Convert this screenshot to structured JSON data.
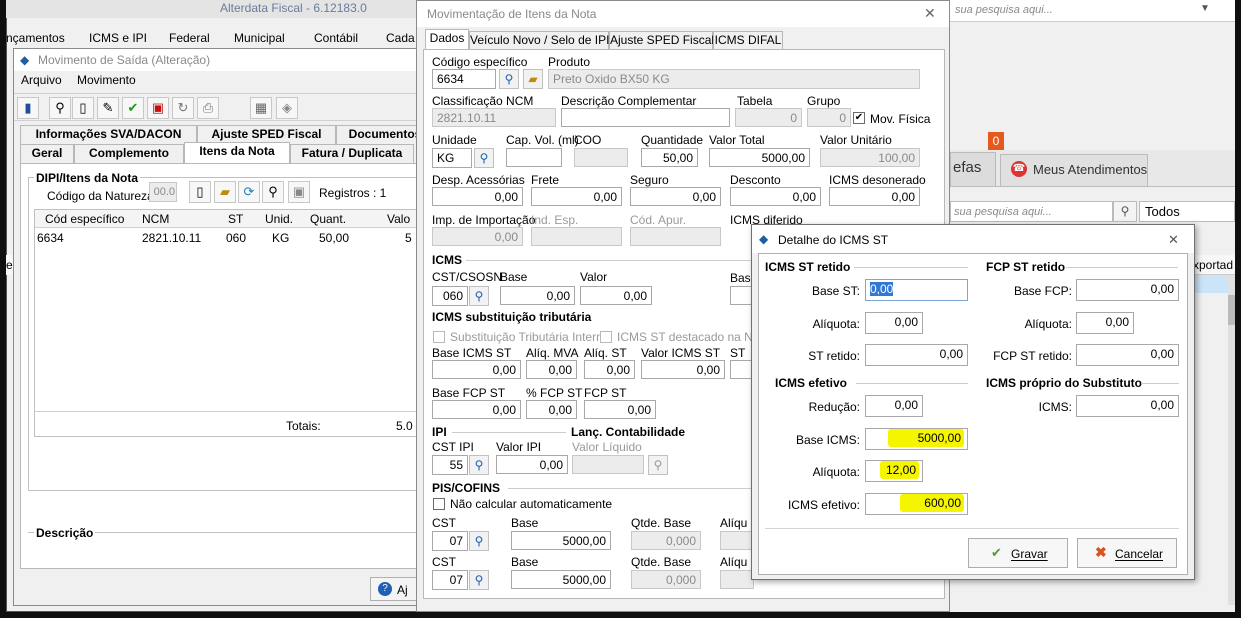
{
  "top": {
    "title_fragment": "Alterdata Fiscal - 6.12183.0",
    "search_placeholder": "sua pesquisa aqui...",
    "menu_items": [
      "nçamentos",
      "ICMS e IPI",
      "Federal",
      "Municipal",
      "Contábil",
      "Cada"
    ]
  },
  "bg_right": {
    "tab_fragment": "efas",
    "badge": "0",
    "tab_meus": "Meus Atendimentos",
    "search_placeholder": "sua pesquisa aqui...",
    "filter_value": "Todos",
    "column_fragment": "xportad",
    "left_fragment": "er"
  },
  "movimento": {
    "title": "Movimento de Saída (Alteração)",
    "menu_arquivo": "Arquivo",
    "menu_movimento": "Movimento",
    "tabs_row1": [
      "Informações SVA/DACON",
      "Ajuste SPED Fiscal",
      "Documentos"
    ],
    "tabs_row2": [
      "Geral",
      "Complemento",
      "Itens da Nota",
      "Fatura / Duplicata"
    ],
    "group_title": "DIPI/Itens da Nota",
    "natureza_label": "Código da Natureza",
    "natureza_value": "00.0",
    "registros_label": "Registros : 1",
    "columns": [
      "Cód específico",
      "NCM",
      "ST",
      "Unid.",
      "Quant.",
      "Valo"
    ],
    "row": [
      "6634",
      "2821.10.11",
      "060",
      "KG",
      "50,00",
      "5"
    ],
    "totais_label": "Totais:",
    "totais_value": "5.0",
    "descricao_label": "Descrição",
    "bottom_button": "Aj"
  },
  "mov_itens": {
    "title": "Movimentação de Itens da Nota",
    "tabs": [
      "Dados",
      "Veículo Novo / Selo de IPI",
      "Ajuste SPED Fiscal",
      "ICMS DIFAL"
    ],
    "codigo_label": "Código específico",
    "codigo_value": "6634",
    "produto_label": "Produto",
    "produto_value": "Preto Oxido BX50 KG",
    "ncm_label": "Classificação NCM",
    "ncm_value": "2821.10.11",
    "desc_comp_label": "Descrição Complementar",
    "tabela_label": "Tabela",
    "tabela_value": "0",
    "grupo_label": "Grupo",
    "grupo_value": "0",
    "mov_fisica_label": "Mov. Física",
    "mov_fisica_check": "✔",
    "unidade_label": "Unidade",
    "unidade_value": "KG",
    "capvol_label": "Cap. Vol. (ml)",
    "coo_label": "COO",
    "quantidade_label": "Quantidade",
    "quantidade_value": "50,00",
    "valor_total_label": "Valor Total",
    "valor_total_value": "5000,00",
    "valor_unit_label": "Valor Unitário",
    "valor_unit_value": "100,00",
    "desp_label": "Desp. Acessórias",
    "desp_value": "0,00",
    "frete_label": "Frete",
    "frete_value": "0,00",
    "seguro_label": "Seguro",
    "seguro_value": "0,00",
    "desconto_label": "Desconto",
    "desconto_value": "0,00",
    "icms_deson_label": "ICMS desonerado",
    "icms_deson_value": "0,00",
    "imp_label": "Imp. de Importação",
    "imp_value": "0,00",
    "ind_esp_label": "Ind. Esp.",
    "cod_apur_label": "Cód. Apur.",
    "icms_dif_label": "ICMS diferido",
    "icms_section": "ICMS",
    "cst_label": "CST/CSOSN",
    "cst_value": "060",
    "base_label": "Base",
    "base_value": "0,00",
    "valor_label": "Valor",
    "valor_value": "0,00",
    "bas_fragment": "Bas",
    "st_section": "ICMS substituição tributária",
    "st_interna_label": "Substituição Tributária Interna",
    "st_destacado_label": "ICMS ST destacado na NF",
    "base_icms_st_label": "Base ICMS ST",
    "base_icms_st_value": "0,00",
    "aliq_mva_label": "Alíq. MVA",
    "aliq_mva_value": "0,00",
    "aliq_st_label": "Alíq. ST",
    "aliq_st_value": "0,00",
    "valor_icms_st_label": "Valor ICMS ST",
    "valor_icms_st_value": "0,00",
    "st_fragment": "ST",
    "base_fcp_st_label": "Base FCP ST",
    "base_fcp_st_value": "0,00",
    "pct_fcp_st_label": "% FCP ST",
    "pct_fcp_st_value": "0,00",
    "fcp_st_label": "FCP ST",
    "fcp_st_value": "0,00",
    "ipi_section": "IPI",
    "lanc_section": "Lanç. Contabilidade",
    "cst_ipi_label": "CST IPI",
    "cst_ipi_value": "55",
    "valor_ipi_label": "Valor IPI",
    "valor_ipi_value": "0,00",
    "valor_liquido_label": "Valor Líquido",
    "pis_section": "PIS/COFINS",
    "nao_calc_label": "Não calcular automaticamente",
    "pis_cst_label": "CST",
    "pis_cst_value": "07",
    "pis_base_label": "Base",
    "pis_base_value": "5000,00",
    "pis_qtde_label": "Qtde. Base",
    "pis_qtde_value": "0,000",
    "pis_aliq_label": "Alíqu",
    "cof_cst_label": "CST",
    "cof_cst_value": "07",
    "cof_base_label": "Base",
    "cof_base_value": "5000,00",
    "cof_qtde_label": "Qtde. Base",
    "cof_qtde_value": "0,000",
    "cof_aliq_label": "Alíqu"
  },
  "detalhe": {
    "title": "Detalhe do ICMS ST",
    "icms_st_retido_section": "ICMS ST retido",
    "fcp_st_retido_section": "FCP ST retido",
    "base_st_label": "Base ST:",
    "base_st_value": "0,00",
    "base_fcp_label": "Base FCP:",
    "base_fcp_value": "0,00",
    "aliquota_label": "Alíquota:",
    "aliquota_value": "0,00",
    "aliquota_fcp_label": "Alíquota:",
    "aliquota_fcp_value": "0,00",
    "st_retido_label": "ST retido:",
    "st_retido_value": "0,00",
    "fcp_st_retido_label": "FCP ST retido:",
    "fcp_st_retido_value": "0,00",
    "icms_efetivo_section": "ICMS efetivo",
    "icms_proprio_section": "ICMS próprio do Substituto",
    "reducao_label": "Redução:",
    "reducao_value": "0,00",
    "icms_label": "ICMS:",
    "icms_value": "0,00",
    "base_icms_label": "Base ICMS:",
    "base_icms_value": "5000,00",
    "aliquota_ef_label": "Alíquota:",
    "aliquota_ef_value": "12,00",
    "icms_efetivo_label": "ICMS efetivo:",
    "icms_efetivo_value": "600,00",
    "gravar": "Gravar",
    "cancelar": "Cancelar",
    "highlight_color": "#f5f500"
  }
}
